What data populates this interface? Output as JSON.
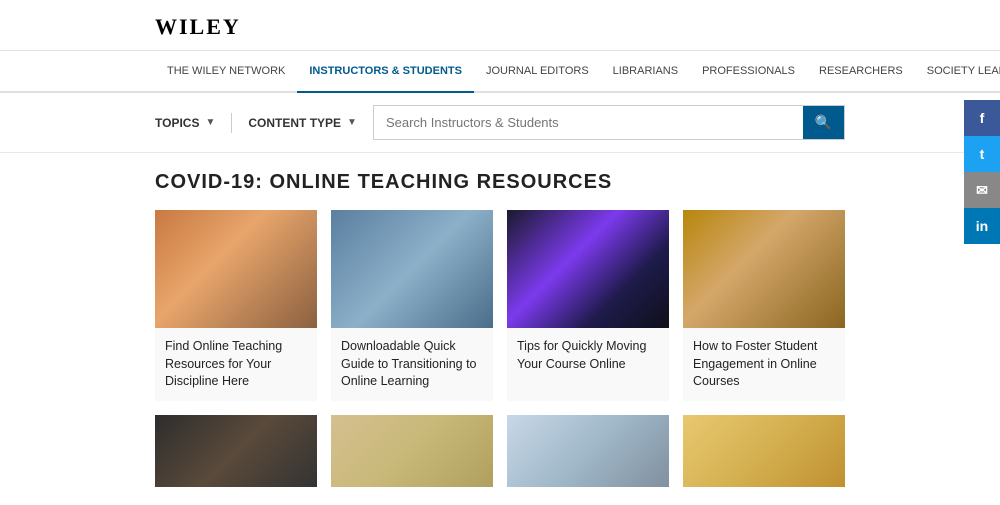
{
  "header": {
    "logo": "WILEY"
  },
  "nav": {
    "items": [
      {
        "label": "THE WILEY NETWORK",
        "active": false
      },
      {
        "label": "INSTRUCTORS & STUDENTS",
        "active": true
      },
      {
        "label": "JOURNAL EDITORS",
        "active": false
      },
      {
        "label": "LIBRARIANS",
        "active": false
      },
      {
        "label": "PROFESSIONALS",
        "active": false
      },
      {
        "label": "RESEARCHERS",
        "active": false
      },
      {
        "label": "SOCIETY LEADERS",
        "active": false
      }
    ]
  },
  "filters": {
    "topics_label": "TOPICS",
    "content_type_label": "CONTENT TYPE",
    "search_placeholder": "Search Instructors & Students"
  },
  "section": {
    "title": "COVID-19: ONLINE TEACHING RESOURCES"
  },
  "cards_row1": [
    {
      "title": "Find Online Teaching Resources for Your Discipline Here",
      "img_class": "img-warm"
    },
    {
      "title": "Downloadable Quick Guide to Transitioning to Online Learning",
      "img_class": "img-blue"
    },
    {
      "title": "Tips for Quickly Moving Your Course Online",
      "img_class": "img-dark"
    },
    {
      "title": "How to Foster Student Engagement in Online Courses",
      "img_class": "img-warm2"
    }
  ],
  "cards_row2": [
    {
      "img_class": "img-p2-1"
    },
    {
      "img_class": "img-p2-2"
    },
    {
      "img_class": "img-p2-3"
    },
    {
      "img_class": "img-p2-4"
    }
  ],
  "social": {
    "facebook": "f",
    "twitter": "t",
    "email": "✉",
    "linkedin": "in"
  }
}
